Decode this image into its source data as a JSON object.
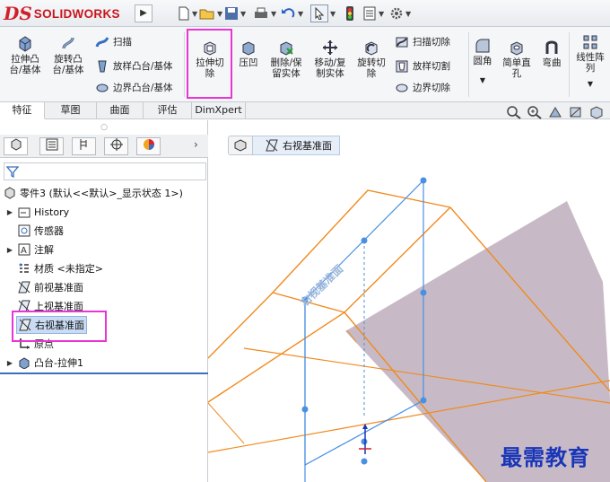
{
  "app": {
    "logo_text": "SOLIDWORKS",
    "logo_mark": "DS",
    "brand_color": "#d0202a"
  },
  "ribbon": {
    "extrude_boss": "拉伸凸\n台/基体",
    "revolve_boss": "旋转凸\n台/基体",
    "sweep": "扫描",
    "loft_boss": "放样凸台/基体",
    "boundary_boss": "边界凸台/基体",
    "extrude_cut": "拉伸切\n除",
    "indent": "压凹",
    "delete_keep_body": "删除/保\n留实体",
    "move_copy_body": "移动/复\n制实体",
    "revolve_cut": "旋转切\n除",
    "swept_cut": "扫描切除",
    "lofted_cut": "放样切割",
    "boundary_cut": "边界切除",
    "fillet": "圆角",
    "simple_hole": "简单直\n孔",
    "flex": "弯曲",
    "linear_pattern": "线性阵\n列"
  },
  "tabs": [
    "特征",
    "草图",
    "曲面",
    "评估",
    "DimXpert"
  ],
  "active_tab": "特征",
  "tree": {
    "root": "零件3  (默认<<默认>_显示状态 1>)",
    "items": [
      "History",
      "传感器",
      "注解",
      "材质 <未指定>",
      "前视基准面",
      "上视基准面",
      "右视基准面",
      "原点",
      "凸台-拉伸1"
    ]
  },
  "selected_item": "右视基准面",
  "breadcrumb": {
    "plane": "右视基准面"
  },
  "viewport": {
    "plane_label": "右视基准面",
    "part_face_color": "#c7bac6",
    "edge_color": "#f08a1e",
    "plane_color": "#4a90e2"
  },
  "watermark": "最需教育"
}
